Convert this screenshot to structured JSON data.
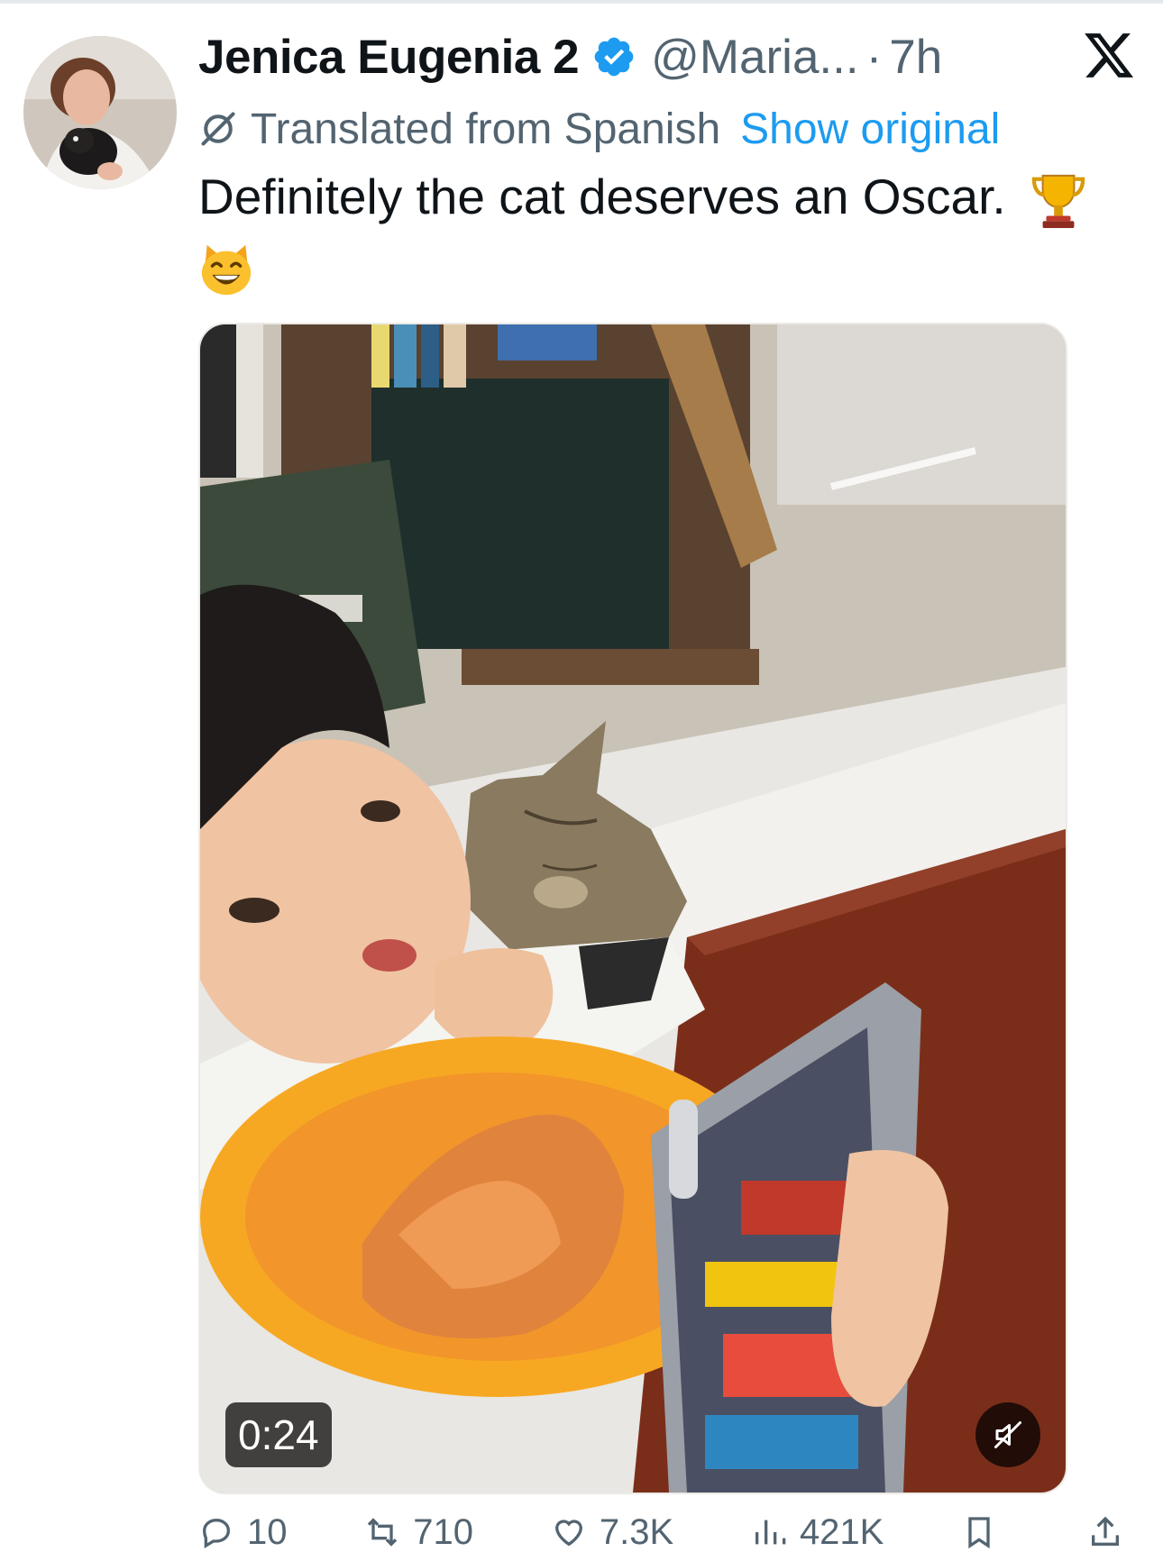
{
  "tweet": {
    "author": {
      "display_name": "Jenica Eugenia 2",
      "handle": "@Maria...",
      "verified": true,
      "avatar": "avatar-photo"
    },
    "timestamp_separator": "·",
    "timestamp": "7h",
    "translation": {
      "label": "Translated from Spanish",
      "show_original": "Show original",
      "icon": "translate-icon"
    },
    "text": "Definitely the cat deserves an Oscar.",
    "emojis": [
      "trophy-emoji",
      "grinning-cat-emoji"
    ],
    "media": {
      "type": "video",
      "duration": "0:24",
      "muted": true,
      "thumbnail": "child eating at table, cat leaning on his shoulder"
    },
    "actions": [
      {
        "name": "reply",
        "icon": "reply-icon",
        "count": "10"
      },
      {
        "name": "repost",
        "icon": "repost-icon",
        "count": "710"
      },
      {
        "name": "like",
        "icon": "like-icon",
        "count": "7.3K"
      },
      {
        "name": "views",
        "icon": "views-icon",
        "count": "421K"
      },
      {
        "name": "bookmark",
        "icon": "bookmark-icon",
        "count": ""
      },
      {
        "name": "share",
        "icon": "share-icon",
        "count": ""
      }
    ]
  },
  "platform": {
    "logo": "x-logo-icon"
  },
  "colors": {
    "text": "#0f1419",
    "secondary_text": "#536471",
    "link": "#1d9bf0",
    "verified_badge": "#1d9bf0",
    "background": "#ffffff"
  }
}
